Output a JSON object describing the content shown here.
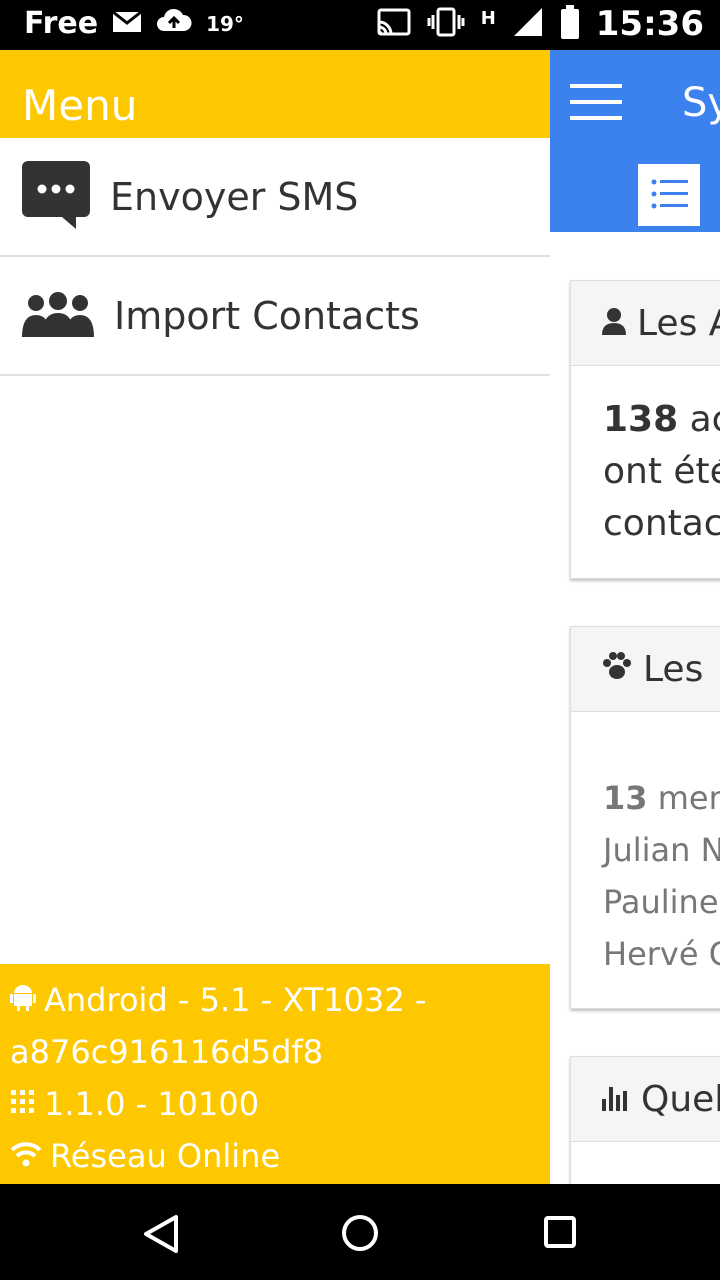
{
  "status_bar": {
    "carrier": "Free",
    "temperature": "19°",
    "network": "H",
    "time": "15:36"
  },
  "app": {
    "title": "Sy",
    "cards": [
      {
        "header": "Les A",
        "bold": "138",
        "line1_rest": " ac",
        "line2": "ont été",
        "line3": "contac"
      },
      {
        "header": "Les",
        "bold": "13",
        "line1_rest": " men",
        "line2": "Julian N",
        "line3": "Pauline",
        "line4": "Hervé C"
      },
      {
        "header": "Quel"
      }
    ]
  },
  "drawer": {
    "title": "Menu",
    "items": [
      {
        "label": "Envoyer SMS",
        "icon": "chat-icon"
      },
      {
        "label": "Import Contacts",
        "icon": "group-icon"
      }
    ],
    "footer": {
      "device": "Android - 5.1 - XT1032 -",
      "device_id": "a876c916116d5df8",
      "version": "1.1.0 - 10100",
      "network": "Réseau Online"
    }
  },
  "colors": {
    "drawer_accent": "#fec800",
    "app_bar": "#3c82ee"
  }
}
